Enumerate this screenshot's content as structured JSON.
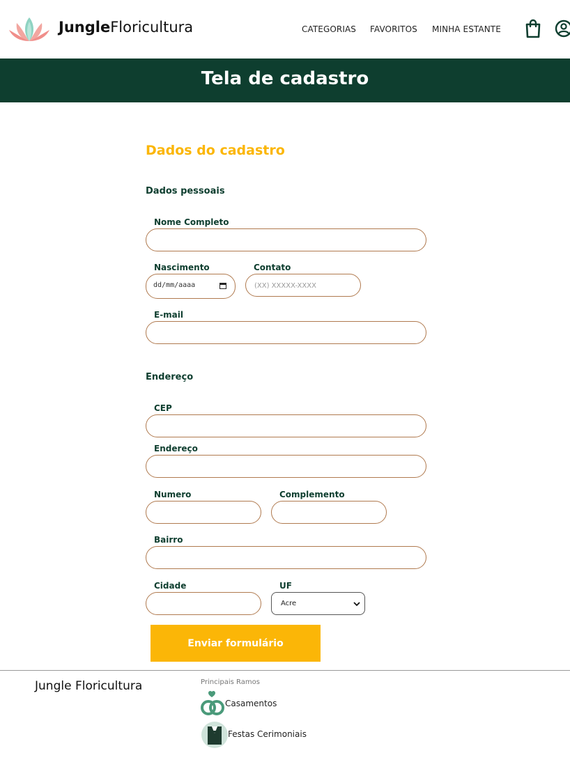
{
  "header": {
    "brand_bold": "Jungle",
    "brand_rest": "Floricultura",
    "nav": [
      "CATEGORIAS",
      "FAVORITOS",
      "MINHA ESTANTE"
    ],
    "icons": [
      "shopping-bag-icon",
      "user-account-icon"
    ]
  },
  "page_title": "Tela de cadastro",
  "form": {
    "title": "Dados do cadastro",
    "personal_heading": "Dados pessoais",
    "nome_label": "Nome Completo",
    "nome_value": "",
    "nascimento_label": "Nascimento",
    "nascimento_placeholder": "dd/mm/aaaa",
    "contato_label": "Contato",
    "contato_placeholder": "(XX) XXXXX-XXXX",
    "email_label": "E-mail",
    "email_value": "",
    "address_heading": "Endereço",
    "cep_label": "CEP",
    "endereco_label": "Endereço",
    "numero_label": "Numero",
    "complemento_label": "Complemento",
    "bairro_label": "Bairro",
    "cidade_label": "Cidade",
    "uf_label": "UF",
    "uf_selected": "Acre",
    "submit_label": "Enviar formulário"
  },
  "footer": {
    "brand": "Jungle Floricultura",
    "heading": "Principais Ramos",
    "items": [
      "Casamentos",
      "Festas Cerimoniais"
    ]
  },
  "colors": {
    "primary_green": "#0e3e2f",
    "accent_yellow": "#fbb607",
    "field_border": "#b07a4f"
  }
}
